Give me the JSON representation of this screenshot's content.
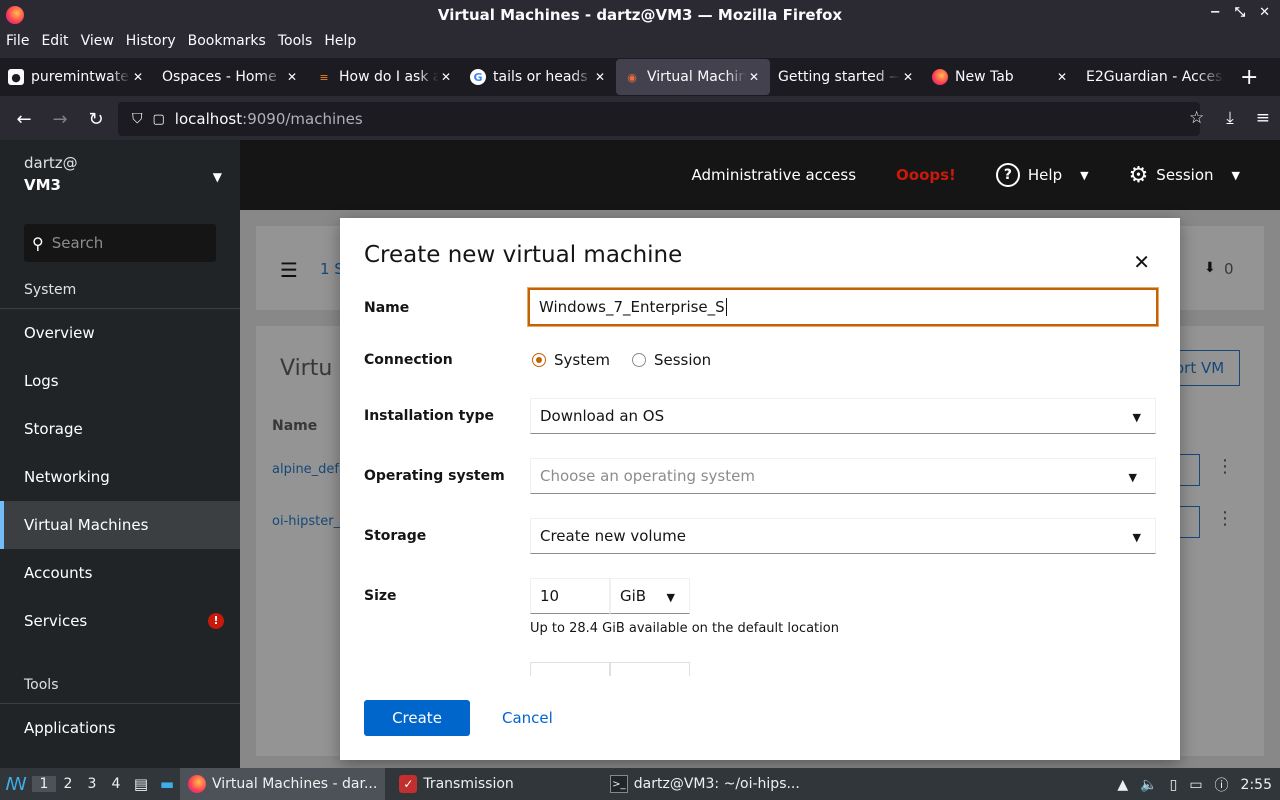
{
  "window": {
    "title": "Virtual Machines - dartz@VM3 — Mozilla Firefox",
    "controls": [
      "−",
      "⤡",
      "✕"
    ]
  },
  "menu": [
    "File",
    "Edit",
    "View",
    "History",
    "Bookmarks",
    "Tools",
    "Help"
  ],
  "tabs": [
    {
      "label": "puremintwater",
      "active": false
    },
    {
      "label": "Ospaces - Home",
      "active": false
    },
    {
      "label": "How do I ask a",
      "active": false
    },
    {
      "label": "tails or heads",
      "active": false
    },
    {
      "label": "Virtual Machine",
      "active": true
    },
    {
      "label": "Getting started —",
      "active": false
    },
    {
      "label": "New Tab",
      "active": false
    },
    {
      "label": "E2Guardian - Access",
      "active": false
    }
  ],
  "url": {
    "host": "localhost",
    "path": ":9090/machines"
  },
  "sidebar": {
    "user": "dartz@",
    "host": "VM3",
    "search_placeholder": "Search",
    "group_system": "System",
    "items": [
      "Overview",
      "Logs",
      "Storage",
      "Networking",
      "Virtual Machines",
      "Accounts",
      "Services"
    ],
    "group_tools": "Tools",
    "tools_items": [
      "Applications"
    ],
    "services_badge": "!"
  },
  "masthead": {
    "admin": "Administrative access",
    "oops": "Ooops!",
    "help": "Help",
    "session": "Session"
  },
  "background": {
    "summary": "1 S",
    "count": "0",
    "section": "Virtu",
    "col_name": "Name",
    "rows": [
      "alpine_defa",
      "oi-hipster_"
    ],
    "import": "ort VM"
  },
  "modal": {
    "title": "Create new virtual machine",
    "name_label": "Name",
    "name_value": "Windows_7_Enterprise_S",
    "connection_label": "Connection",
    "connection_options": [
      "System",
      "Session"
    ],
    "install_label": "Installation type",
    "install_value": "Download an OS",
    "os_label": "Operating system",
    "os_placeholder": "Choose an operating system",
    "storage_label": "Storage",
    "storage_value": "Create new volume",
    "size_label": "Size",
    "size_value": "10",
    "size_unit": "GiB",
    "size_helper": "Up to 28.4 GiB available on the default location",
    "create": "Create",
    "cancel": "Cancel"
  },
  "taskbar": {
    "workspaces": [
      "1",
      "2",
      "3",
      "4"
    ],
    "tasks": [
      "Virtual Machines - dar...",
      "Transmission",
      "dartz@VM3: ~/oi-hips..."
    ],
    "clock": "2:55"
  }
}
